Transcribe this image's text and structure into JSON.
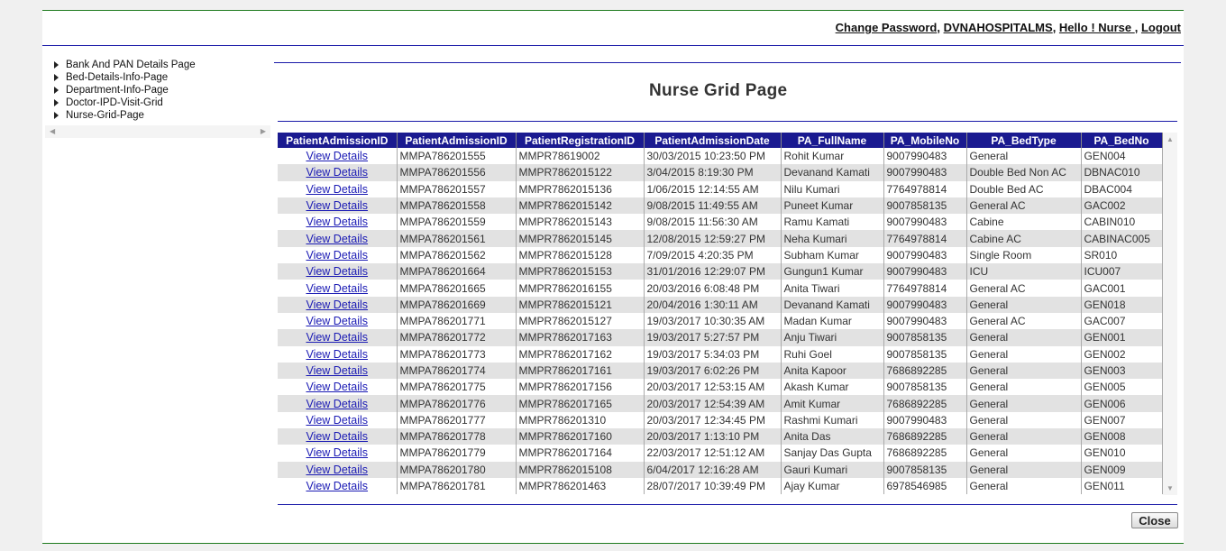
{
  "header": {
    "change_password": "Change Password",
    "hospital": "DVNAHOSPITALMS",
    "greeting": "Hello ! Nurse ",
    "logout": "Logout"
  },
  "nav_tree": {
    "items": [
      {
        "label": "Bank And PAN Details Page"
      },
      {
        "label": "Bed-Details-Info-Page"
      },
      {
        "label": "Department-Info-Page"
      },
      {
        "label": "Doctor-IPD-Visit-Grid"
      },
      {
        "label": "Nurse-Grid-Page"
      }
    ]
  },
  "page_title": "Nurse Grid Page",
  "grid": {
    "link_label": "View Details",
    "columns": [
      "PatientAdmissionID",
      "PatientAdmissionID",
      "PatientRegistrationID",
      "PatientAdmissionDate",
      "PA_FullName",
      "PA_MobileNo",
      "PA_BedType",
      "PA_BedNo"
    ],
    "rows": [
      [
        "MMPA786201555",
        "MMPR78619002",
        "30/03/2015 10:23:50 PM",
        "Rohit Kumar",
        "9007990483",
        "General",
        "GEN004"
      ],
      [
        "MMPA786201556",
        "MMPR7862015122",
        "3/04/2015 8:19:30 PM",
        "Devanand Kamati",
        "9007990483",
        "Double Bed Non AC",
        "DBNAC010"
      ],
      [
        "MMPA786201557",
        "MMPR7862015136",
        "1/06/2015 12:14:55 AM",
        "Nilu Kumari",
        "7764978814",
        "Double Bed AC",
        "DBAC004"
      ],
      [
        "MMPA786201558",
        "MMPR7862015142",
        "9/08/2015 11:49:55 AM",
        "Puneet Kumar",
        "9007858135",
        "General AC",
        "GAC002"
      ],
      [
        "MMPA786201559",
        "MMPR7862015143",
        "9/08/2015 11:56:30 AM",
        "Ramu Kamati",
        "9007990483",
        "Cabine",
        "CABIN010"
      ],
      [
        "MMPA786201561",
        "MMPR7862015145",
        "12/08/2015 12:59:27 PM",
        "Neha Kumari",
        "7764978814",
        "Cabine AC",
        "CABINAC005"
      ],
      [
        "MMPA786201562",
        "MMPR7862015128",
        "7/09/2015 4:20:35 PM",
        "Subham Kumar",
        "9007990483",
        "Single Room",
        "SR010"
      ],
      [
        "MMPA786201664",
        "MMPR7862015153",
        "31/01/2016 12:29:07 PM",
        "Gungun1 Kumar",
        "9007990483",
        "ICU",
        "ICU007"
      ],
      [
        "MMPA786201665",
        "MMPR7862016155",
        "20/03/2016 6:08:48 PM",
        "Anita Tiwari",
        "7764978814",
        "General AC",
        "GAC001"
      ],
      [
        "MMPA786201669",
        "MMPR7862015121",
        "20/04/2016 1:30:11 AM",
        "Devanand Kamati",
        "9007990483",
        "General",
        "GEN018"
      ],
      [
        "MMPA786201771",
        "MMPR7862015127",
        "19/03/2017 10:30:35 AM",
        "Madan Kumar",
        "9007990483",
        "General AC",
        "GAC007"
      ],
      [
        "MMPA786201772",
        "MMPR7862017163",
        "19/03/2017 5:27:57 PM",
        "Anju Tiwari",
        "9007858135",
        "General",
        "GEN001"
      ],
      [
        "MMPA786201773",
        "MMPR7862017162",
        "19/03/2017 5:34:03 PM",
        "Ruhi Goel",
        "9007858135",
        "General",
        "GEN002"
      ],
      [
        "MMPA786201774",
        "MMPR7862017161",
        "19/03/2017 6:02:26 PM",
        "Anita Kapoor",
        "7686892285",
        "General",
        "GEN003"
      ],
      [
        "MMPA786201775",
        "MMPR7862017156",
        "20/03/2017 12:53:15 AM",
        "Akash Kumar",
        "9007858135",
        "General",
        "GEN005"
      ],
      [
        "MMPA786201776",
        "MMPR7862017165",
        "20/03/2017 12:54:39 AM",
        "Amit Kumar",
        "7686892285",
        "General",
        "GEN006"
      ],
      [
        "MMPA786201777",
        "MMPR786201310",
        "20/03/2017 12:34:45 PM",
        "Rashmi Kumari",
        "9007990483",
        "General",
        "GEN007"
      ],
      [
        "MMPA786201778",
        "MMPR7862017160",
        "20/03/2017 1:13:10 PM",
        "Anita Das",
        "7686892285",
        "General",
        "GEN008"
      ],
      [
        "MMPA786201779",
        "MMPR7862017164",
        "22/03/2017 12:51:12 AM",
        "Sanjay Das Gupta",
        "7686892285",
        "General",
        "GEN010"
      ],
      [
        "MMPA786201780",
        "MMPR7862015108",
        "6/04/2017 12:16:28 AM",
        "Gauri Kumari",
        "9007858135",
        "General",
        "GEN009"
      ],
      [
        "MMPA786201781",
        "MMPR786201463",
        "28/07/2017 10:39:49 PM",
        "Ajay Kumar",
        "6978546985",
        "General",
        "GEN011"
      ]
    ]
  },
  "close_label": "Close"
}
